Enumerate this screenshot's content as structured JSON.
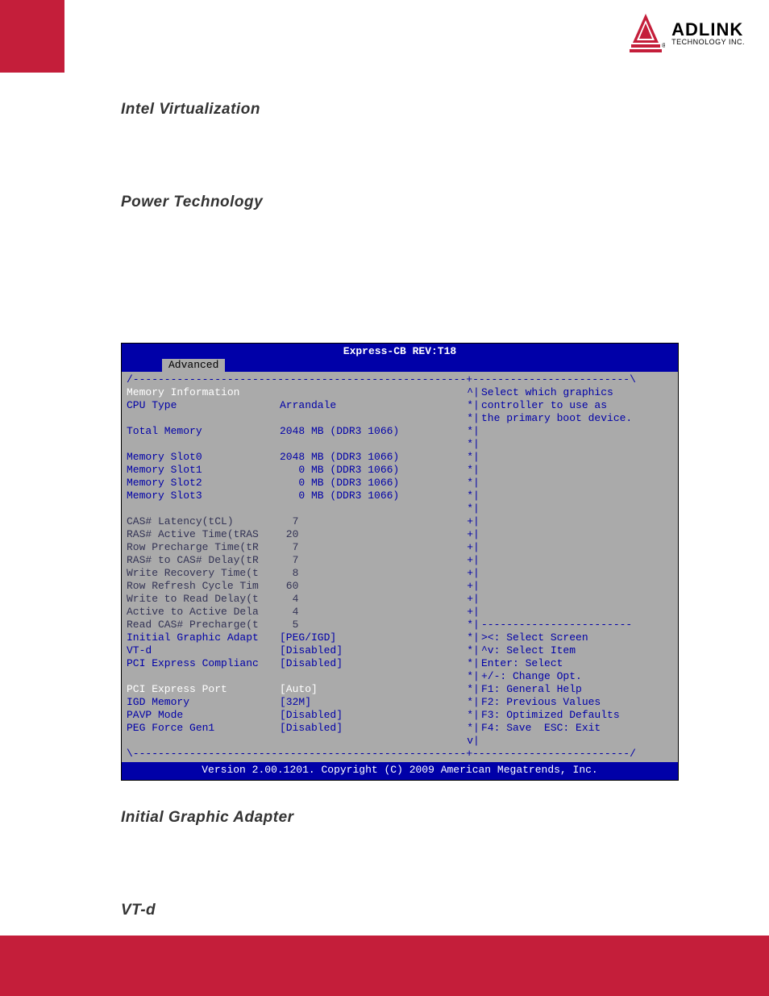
{
  "logo": {
    "brand": "ADLINK",
    "tagline": "TECHNOLOGY INC."
  },
  "sections": {
    "h1": "Intel Virtualization",
    "h2": "Power Technology",
    "h3": "Initial Graphic Adapter",
    "h4": "VT-d"
  },
  "bios": {
    "title": "Express-CB REV:T18",
    "tab": "Advanced",
    "header": "Memory Information",
    "help1": "Select which graphics",
    "help2": "controller to use as",
    "help3": "the primary boot device.",
    "rows": {
      "cpu_type_l": "CPU Type",
      "cpu_type_v": "Arrandale",
      "total_mem_l": "Total Memory",
      "total_mem_v": "2048 MB (DDR3 1066)",
      "slot0_l": "Memory Slot0",
      "slot0_v": "2048 MB (DDR3 1066)",
      "slot1_l": "Memory Slot1",
      "slot1_v": "   0 MB (DDR3 1066)",
      "slot2_l": "Memory Slot2",
      "slot2_v": "   0 MB (DDR3 1066)",
      "slot3_l": "Memory Slot3",
      "slot3_v": "   0 MB (DDR3 1066)",
      "cas_l": "CAS# Latency(tCL)",
      "cas_v": "  7",
      "ras_act_l": "RAS# Active Time(tRAS",
      "ras_act_v": " 20",
      "row_pre_l": "Row Precharge Time(tR",
      "row_pre_v": "  7",
      "ras_cas_l": "RAS# to CAS# Delay(tR",
      "ras_cas_v": "  7",
      "write_rec_l": "Write Recovery Time(t",
      "write_rec_v": "  8",
      "row_ref_l": "Row Refresh Cycle Tim",
      "row_ref_v": " 60",
      "wtr_l": "Write to Read Delay(t",
      "wtr_v": "  4",
      "act_act_l": "Active to Active Dela",
      "act_act_v": "  4",
      "read_cas_l": "Read CAS# Precharge(t",
      "read_cas_v": "  5",
      "iga_l": "Initial Graphic Adapt",
      "iga_v": "[PEG/IGD]",
      "vtd_l": "VT-d",
      "vtd_v": "[Disabled]",
      "pciec_l": "PCI Express Complianc",
      "pciec_v": "[Disabled]",
      "pciep_l": "PCI Express Port",
      "pciep_v": "[Auto]",
      "igd_l": "IGD Memory",
      "igd_v": "[32M]",
      "pavp_l": "PAVP Mode",
      "pavp_v": "[Disabled]",
      "peg_l": "PEG Force Gen1",
      "peg_v": "[Disabled]"
    },
    "nav": {
      "n1": "><: Select Screen",
      "n2": "^v: Select Item",
      "n3": "Enter: Select",
      "n4": "+/-: Change Opt.",
      "n5": "F1: General Help",
      "n6": "F2: Previous Values",
      "n7": "F3: Optimized Defaults",
      "n8": "F4: Save  ESC: Exit"
    },
    "footer": "Version 2.00.1201. Copyright (C) 2009 American Megatrends, Inc."
  }
}
